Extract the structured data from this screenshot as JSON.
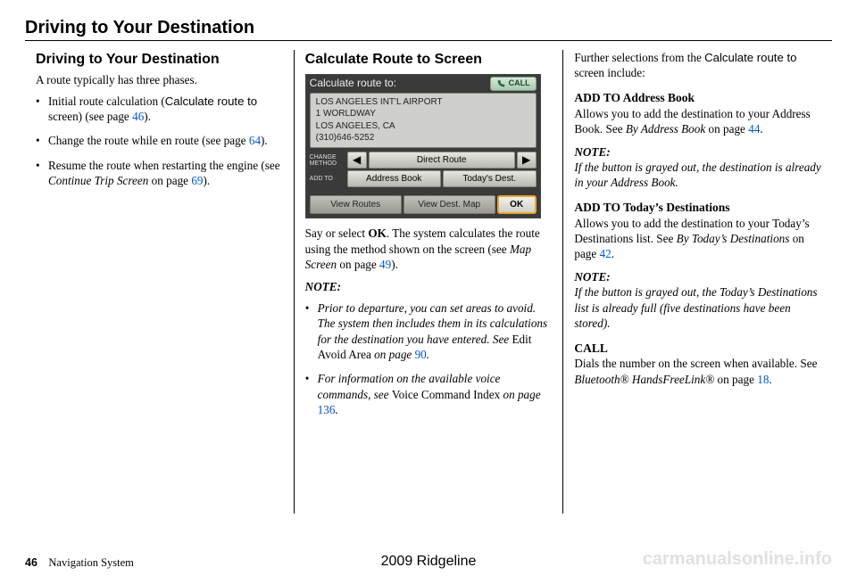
{
  "page_title": "Driving to Your Destination",
  "footer": {
    "page_number": "46",
    "section": "Navigation System",
    "vehicle": "2009  Ridgeline",
    "watermark": "carmanualsonline.info"
  },
  "col1": {
    "heading": "Driving to Your Destination",
    "intro": "A route typically has three phases.",
    "b1_a": "Initial route calculation (",
    "b1_b": "Calculate route to",
    "b1_c": " screen) (see page ",
    "b1_link": "46",
    "b1_d": ").",
    "b2_a": "Change the route while en route (see page ",
    "b2_link": "64",
    "b2_b": ").",
    "b3_a": "Resume the route when restarting the engine (see ",
    "b3_i": "Continue Trip Screen",
    "b3_b": " on page ",
    "b3_link": "69",
    "b3_c": ")."
  },
  "col2": {
    "heading": "Calculate Route to Screen",
    "screen": {
      "title": "Calculate route to:",
      "call": "CALL",
      "line1": "LOS ANGELES INT'L AIRPORT",
      "line2": "1 WORLDWAY",
      "line3": "LOS ANGELES, CA",
      "line4": "(310)646-5252",
      "change_method": "CHANGE METHOD",
      "left_arrow": "◀",
      "direct_route": "Direct Route",
      "right_arrow": "▶",
      "addto": "ADD TO",
      "address_book": "Address Book",
      "todays_dest": "Today's Dest.",
      "view_routes": "View Routes",
      "view_dest_map": "View Dest. Map",
      "ok": "OK"
    },
    "p1_a": "Say or select ",
    "p1_b": "OK",
    "p1_c": ". The system calculates the route using the method shown on the screen (see ",
    "p1_i": "Map Screen",
    "p1_d": " on page ",
    "p1_link": "49",
    "p1_e": ").",
    "note_label": "NOTE:",
    "n1_a": "Prior to departure, you can set areas to avoid. The system then includes them in its calculations for the destination you have entered. See ",
    "n1_b": "Edit Avoid Area",
    "n1_c": " on page ",
    "n1_link": "90",
    "n1_d": ".",
    "n2_a": "For information on the available voice commands, see ",
    "n2_b": "Voice Command Index",
    "n2_c": " on page ",
    "n2_link": "136",
    "n2_d": "."
  },
  "col3": {
    "p1_a": "Further selections from the ",
    "p1_b": "Calculate route to",
    "p1_c": " screen include:",
    "h1": "ADD TO Address Book",
    "h1_p_a": "Allows you to add the destination to your Address Book. See ",
    "h1_p_i": "By Address Book",
    "h1_p_b": " on page ",
    "h1_link": "44",
    "h1_p_c": ".",
    "note_label": "NOTE:",
    "n1": "If the button is grayed out, the destination is already in your Address Book.",
    "h2": "ADD TO Today’s Destinations",
    "h2_p_a": "Allows you to add the destination to your Today’s Destinations list. See ",
    "h2_p_i": "By Today’s Destinations",
    "h2_p_b": " on page ",
    "h2_link": "42",
    "h2_p_c": ".",
    "n2": "If the button is grayed out, the Today’s Destinations list is already full (five destinations have been stored).",
    "h3": "CALL",
    "h3_p_a": "Dials the number on the screen when available. See ",
    "h3_p_i": "Bluetooth® HandsFreeLink®",
    "h3_p_b": " on page ",
    "h3_link": "18",
    "h3_p_c": "."
  }
}
